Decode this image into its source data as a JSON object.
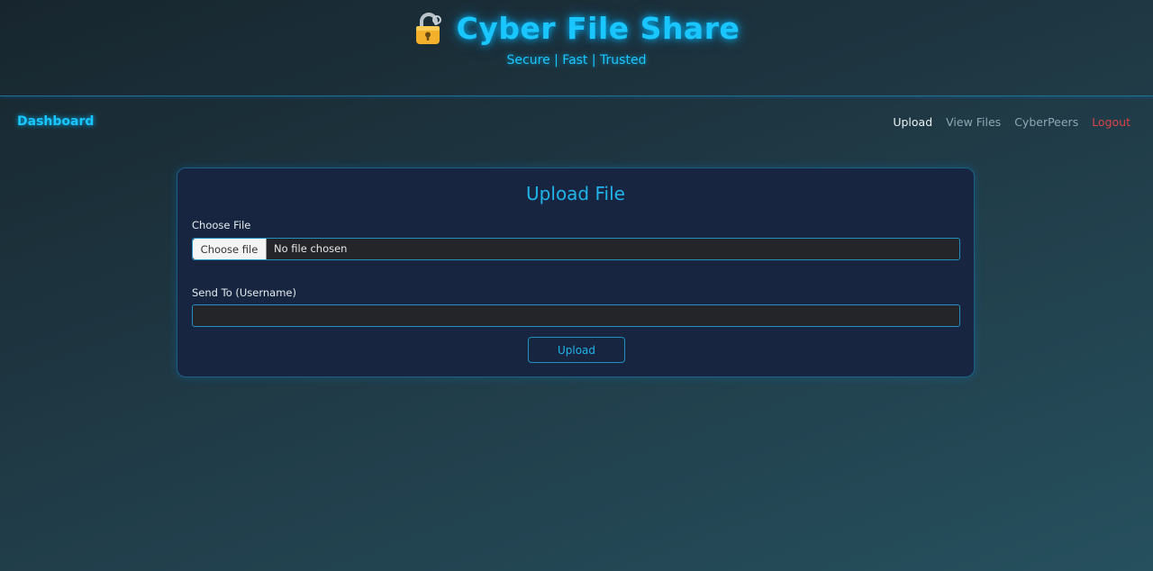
{
  "header": {
    "title": "Cyber File Share",
    "tagline": "Secure | Fast | Trusted",
    "logo_icon": "lock-icon"
  },
  "nav": {
    "brand": "Dashboard",
    "links": [
      {
        "label": "Upload",
        "state": "active"
      },
      {
        "label": "View Files",
        "state": "normal"
      },
      {
        "label": "CyberPeers",
        "state": "normal"
      },
      {
        "label": "Logout",
        "state": "danger"
      }
    ]
  },
  "upload_form": {
    "title": "Upload File",
    "file_label": "Choose File",
    "file_button": "Choose file",
    "file_status": "No file chosen",
    "recipient_label": "Send To (Username)",
    "recipient_value": "",
    "submit_label": "Upload"
  },
  "colors": {
    "accent": "#1ac6ff",
    "logout": "#d9444a",
    "card_background": "#172540",
    "border": "#1f90bf"
  }
}
